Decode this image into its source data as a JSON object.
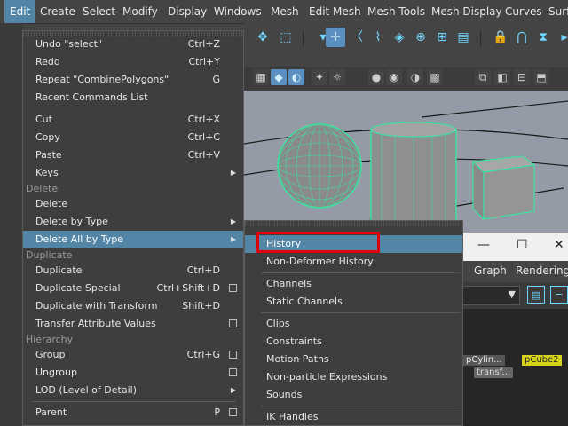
{
  "menubar": {
    "items": [
      "Edit",
      "Create",
      "Select",
      "Modify",
      "Display",
      "Windows",
      "Mesh",
      "Edit Mesh",
      "Mesh Tools",
      "Mesh Display",
      "Curves",
      "Surf"
    ]
  },
  "edit_menu": {
    "items": [
      {
        "label": "Undo \"select\"",
        "shortcut": "Ctrl+Z"
      },
      {
        "label": "Redo",
        "shortcut": "Ctrl+Y"
      },
      {
        "label": "Repeat \"CombinePolygons\"",
        "shortcut": "G"
      },
      {
        "label": "Recent Commands List",
        "shortcut": ""
      },
      {
        "label": "Cut",
        "shortcut": "Ctrl+X"
      },
      {
        "label": "Copy",
        "shortcut": "Ctrl+C"
      },
      {
        "label": "Paste",
        "shortcut": "Ctrl+V"
      },
      {
        "label": "Keys",
        "shortcut": ""
      },
      {
        "label": "Delete",
        "shortcut": ""
      },
      {
        "label": "Delete by Type",
        "shortcut": ""
      },
      {
        "label": "Delete All by Type",
        "shortcut": ""
      },
      {
        "label": "Duplicate",
        "shortcut": "Ctrl+D"
      },
      {
        "label": "Duplicate Special",
        "shortcut": "Ctrl+Shift+D"
      },
      {
        "label": "Duplicate with Transform",
        "shortcut": "Shift+D"
      },
      {
        "label": "Transfer Attribute Values",
        "shortcut": ""
      },
      {
        "label": "Group",
        "shortcut": "Ctrl+G"
      },
      {
        "label": "Ungroup",
        "shortcut": ""
      },
      {
        "label": "LOD (Level of Detail)",
        "shortcut": ""
      },
      {
        "label": "Parent",
        "shortcut": "P"
      }
    ],
    "sections": [
      "Delete",
      "Duplicate",
      "Hierarchy"
    ]
  },
  "submenu": {
    "items": [
      "History",
      "Non-Deformer History",
      "Channels",
      "Static Channels",
      "Clips",
      "Constraints",
      "Motion Paths",
      "Non-particle Expressions",
      "Sounds",
      "IK Handles"
    ]
  },
  "side_window": {
    "menu": [
      "Graph",
      "Rendering"
    ],
    "nodes": [
      "pCylin...",
      "pCube2",
      "transf..."
    ]
  },
  "colors": {
    "accent": "#5285a6",
    "highlight_box": "#e0000a",
    "wireframe": "#3fe0a0"
  }
}
